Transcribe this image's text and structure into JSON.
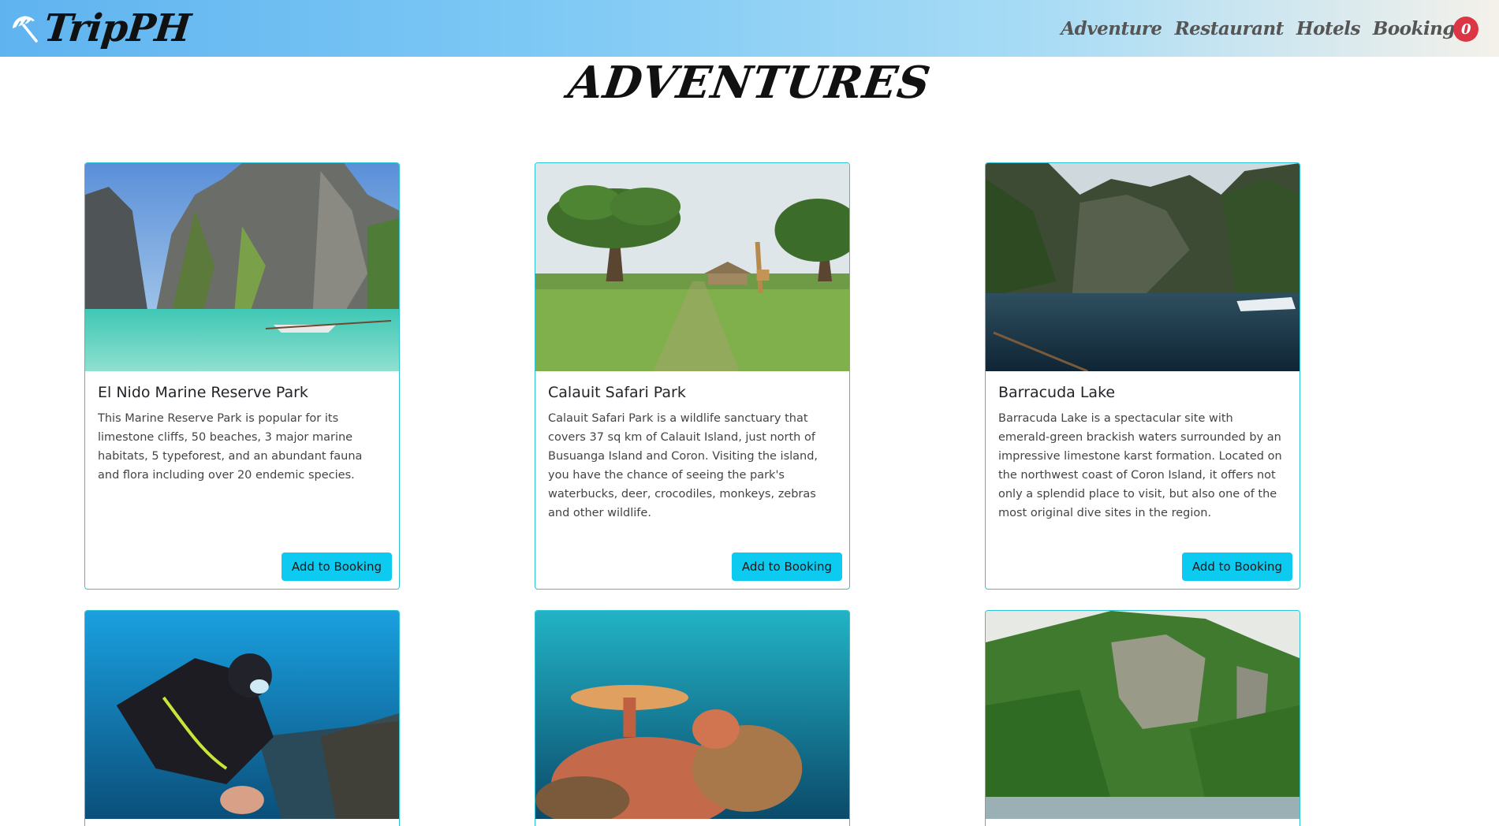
{
  "navbar": {
    "brand": "TripPH",
    "links": [
      "Adventure",
      "Restaurant",
      "Hotels",
      "Booking"
    ],
    "booking_count": "0"
  },
  "page": {
    "title": "ADVENTURES"
  },
  "cards": [
    {
      "title": "El Nido Marine Reserve Park",
      "text": "This Marine Reserve Park is popular for its limestone cliffs, 50 beaches, 3 major marine habitats, 5 typeforest, and an abundant fauna and flora including over 20 endemic species.",
      "button": "Add to Booking"
    },
    {
      "title": "Calauit Safari Park",
      "text": "Calauit Safari Park is a wildlife sanctuary that covers 37 sq km of Calauit Island, just north of Busuanga Island and Coron. Visiting the island, you have the chance of seeing the park's waterbucks, deer, crocodiles, monkeys, zebras and other wildlife.",
      "button": "Add to Booking"
    },
    {
      "title": "Barracuda Lake",
      "text": "Barracuda Lake is a spectacular site with emerald-green brackish waters surrounded by an impressive limestone karst formation. Located on the northwest coast of Coron Island, it offers not only a splendid place to visit, but also one of the most original dive sites in the region.",
      "button": "Add to Booking"
    }
  ]
}
